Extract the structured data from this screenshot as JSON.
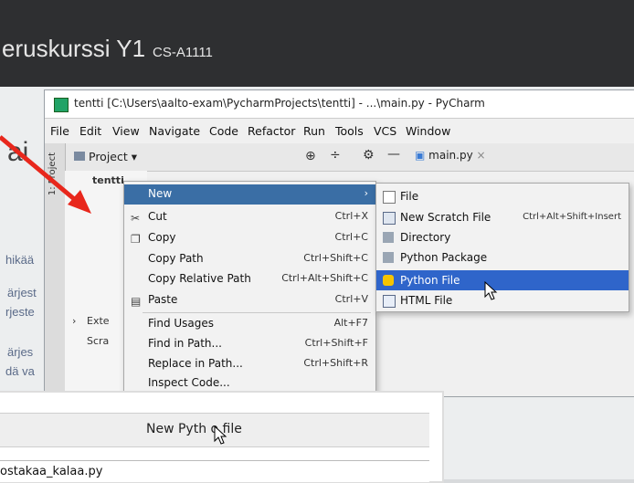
{
  "background": {
    "course_title": "eruskurssi Y1",
    "course_code": "CS-A1111",
    "big_fragment": "ai",
    "left_fragments": [
      "hikää",
      "ärjest",
      "rjeste",
      "ärjes",
      "dä va"
    ]
  },
  "ide": {
    "window_title": "tentti [C:\\Users\\aalto-exam\\PycharmProjects\\tentti] - ...\\main.py - PyCharm",
    "menu": [
      "File",
      "Edit",
      "View",
      "Navigate",
      "Code",
      "Refactor",
      "Run",
      "Tools",
      "VCS",
      "Window"
    ],
    "project_label": "Project",
    "side_tab": "1: Project",
    "editor_tab": "main.py",
    "tree": [
      "tentti",
      "Exte",
      "Scra"
    ]
  },
  "context_menu": {
    "items": [
      {
        "label": "New",
        "shortcut": "",
        "icon": ""
      },
      {
        "label": "Cut",
        "shortcut": "Ctrl+X",
        "icon": "scissors-icon"
      },
      {
        "label": "Copy",
        "shortcut": "Ctrl+C",
        "icon": "copy-icon"
      },
      {
        "label": "Copy Path",
        "shortcut": "Ctrl+Shift+C",
        "icon": ""
      },
      {
        "label": "Copy Relative Path",
        "shortcut": "Ctrl+Alt+Shift+C",
        "icon": ""
      },
      {
        "label": "Paste",
        "shortcut": "Ctrl+V",
        "icon": "paste-icon"
      },
      {
        "label": "Find Usages",
        "shortcut": "Alt+F7",
        "icon": ""
      },
      {
        "label": "Find in Path...",
        "shortcut": "Ctrl+Shift+F",
        "icon": ""
      },
      {
        "label": "Replace in Path...",
        "shortcut": "Ctrl+Shift+R",
        "icon": ""
      },
      {
        "label": "Inspect Code...",
        "shortcut": "",
        "icon": ""
      }
    ]
  },
  "submenu": {
    "items": [
      {
        "label": "File",
        "shortcut": "",
        "icon": "file-icon"
      },
      {
        "label": "New Scratch File",
        "shortcut": "Ctrl+Alt+Shift+Insert",
        "icon": "scratch-file-icon"
      },
      {
        "label": "Directory",
        "shortcut": "",
        "icon": "folder-icon"
      },
      {
        "label": "Python Package",
        "shortcut": "",
        "icon": "package-icon"
      },
      {
        "label": "Python File",
        "shortcut": "",
        "icon": "python-file-icon"
      },
      {
        "label": "HTML File",
        "shortcut": "",
        "icon": "html-file-icon"
      }
    ]
  },
  "dialog": {
    "title": "New Pyth  o file",
    "input_value": "ostakaa_kalaa.py"
  },
  "colors": {
    "selection": "#3a6ea5",
    "submenu_selection": "#2f65ca",
    "arrow": "#e8271c"
  }
}
